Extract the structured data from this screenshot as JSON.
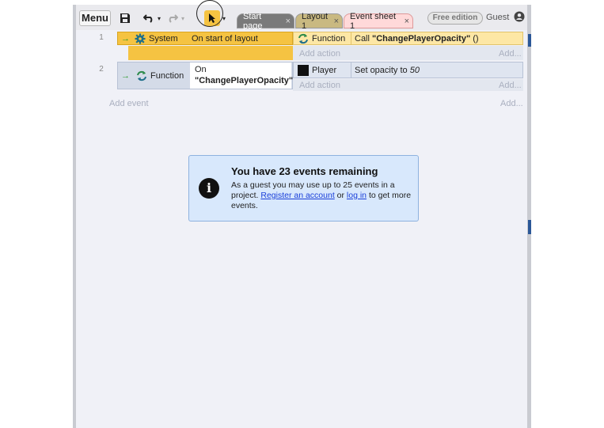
{
  "toolbar": {
    "menu_label": "Menu",
    "icons": [
      "save-icon",
      "undo-icon",
      "redo-icon",
      "pointer-icon"
    ],
    "tabs": [
      {
        "label": "Start page",
        "close": "×"
      },
      {
        "label": "Layout 1",
        "close": "×"
      },
      {
        "label": "Event sheet 1",
        "close": "×"
      }
    ],
    "edition_badge": "Free edition",
    "user_label": "Guest"
  },
  "events": [
    {
      "number": "1",
      "condition_object": "System",
      "condition_text": "On start of layout",
      "action_object": "Function",
      "action_prefix": "Call ",
      "action_name": "\"ChangePlayerOpacity\"",
      "action_suffix": " ()",
      "add_action": "Add action",
      "add_more": "Add..."
    },
    {
      "number": "2",
      "condition_object": "Function",
      "condition_line1": "On",
      "condition_line2": "\"ChangePlayerOpacity\"",
      "action_object": "Player",
      "action_prefix": "Set opacity to ",
      "action_value": "50",
      "add_action": "Add action",
      "add_more": "Add..."
    }
  ],
  "add_event": "Add event",
  "add_event_more": "Add...",
  "notice": {
    "title": "You have 23 events remaining",
    "body_1": "As a guest you may use up to 25 events in a project. ",
    "register_link": "Register an account",
    "body_2": " or ",
    "login_link": "log in",
    "body_3": " to get more events."
  },
  "colors": {
    "system_event": "#f5c342",
    "tab_sheet": "#ffd9d9",
    "info_bg": "#d8e8fc"
  }
}
